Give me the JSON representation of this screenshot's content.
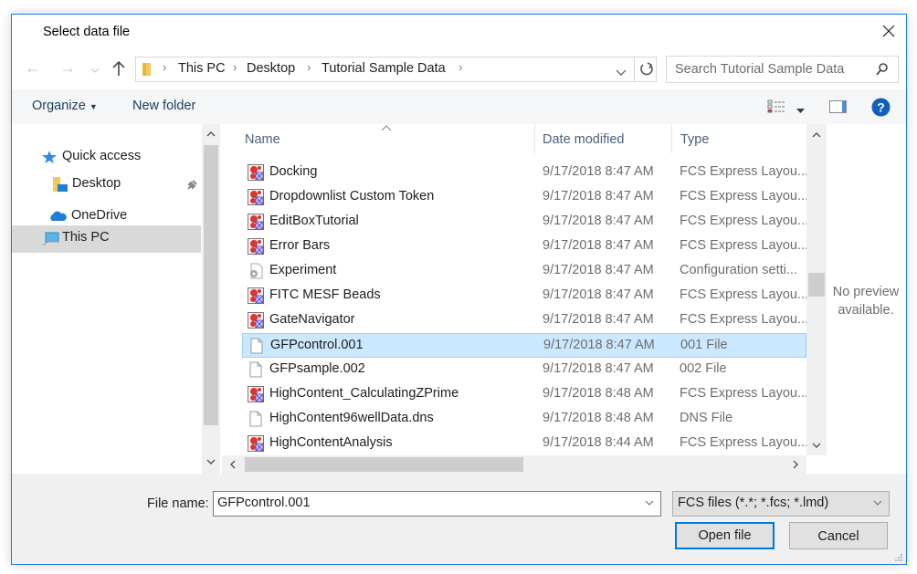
{
  "window": {
    "title": "Select data file"
  },
  "navigation": {
    "breadcrumb": [
      "This PC",
      "Desktop",
      "Tutorial Sample Data"
    ],
    "search_placeholder": "Search Tutorial Sample Data"
  },
  "toolbar": {
    "organize_label": "Organize",
    "new_folder_label": "New folder"
  },
  "sidebar": {
    "items": [
      {
        "label": "Quick access",
        "icon": "star-icon"
      },
      {
        "label": "Desktop",
        "icon": "desktop-folder-icon",
        "pinned": true
      },
      {
        "label": "OneDrive",
        "icon": "cloud-icon"
      },
      {
        "label": "This PC",
        "icon": "computer-icon",
        "selected": true
      }
    ]
  },
  "file_list": {
    "columns": [
      "Name",
      "Date modified",
      "Type"
    ],
    "rows": [
      {
        "name": "Docking",
        "date": "9/17/2018 8:47 AM",
        "type": "FCS Express Layou...",
        "icon": "fcs-layout-icon"
      },
      {
        "name": "Dropdownlist Custom Token",
        "date": "9/17/2018 8:47 AM",
        "type": "FCS Express Layou...",
        "icon": "fcs-layout-icon"
      },
      {
        "name": "EditBoxTutorial",
        "date": "9/17/2018 8:47 AM",
        "type": "FCS Express Layou...",
        "icon": "fcs-layout-icon"
      },
      {
        "name": "Error Bars",
        "date": "9/17/2018 8:47 AM",
        "type": "FCS Express Layou...",
        "icon": "fcs-layout-icon"
      },
      {
        "name": "Experiment",
        "date": "9/17/2018 8:47 AM",
        "type": "Configuration setti...",
        "icon": "config-file-icon"
      },
      {
        "name": "FITC MESF Beads",
        "date": "9/17/2018 8:47 AM",
        "type": "FCS Express Layou...",
        "icon": "fcs-layout-icon"
      },
      {
        "name": "GateNavigator",
        "date": "9/17/2018 8:47 AM",
        "type": "FCS Express Layou...",
        "icon": "fcs-layout-icon"
      },
      {
        "name": "GFPcontrol.001",
        "date": "9/17/2018 8:47 AM",
        "type": "001 File",
        "icon": "blank-file-icon",
        "selected": true
      },
      {
        "name": "GFPsample.002",
        "date": "9/17/2018 8:47 AM",
        "type": "002 File",
        "icon": "blank-file-icon"
      },
      {
        "name": "HighContent_CalculatingZPrime",
        "date": "9/17/2018 8:48 AM",
        "type": "FCS Express Layou...",
        "icon": "fcs-layout-icon"
      },
      {
        "name": "HighContent96wellData.dns",
        "date": "9/17/2018 8:48 AM",
        "type": "DNS File",
        "icon": "blank-file-icon"
      },
      {
        "name": "HighContentAnalysis",
        "date": "9/17/2018 8:44 AM",
        "type": "FCS Express Layou...",
        "icon": "fcs-layout-icon"
      }
    ]
  },
  "preview": {
    "text_line1": "No preview",
    "text_line2": "available."
  },
  "footer": {
    "file_name_label": "File name:",
    "file_name_value": "GFPcontrol.001",
    "file_type_value": "FCS files (*.*; *.fcs; *.lmd)",
    "open_label": "Open file",
    "cancel_label": "Cancel"
  },
  "colors": {
    "accent": "#0078d7",
    "selection": "#cce8ff",
    "help": "#1160b9"
  }
}
